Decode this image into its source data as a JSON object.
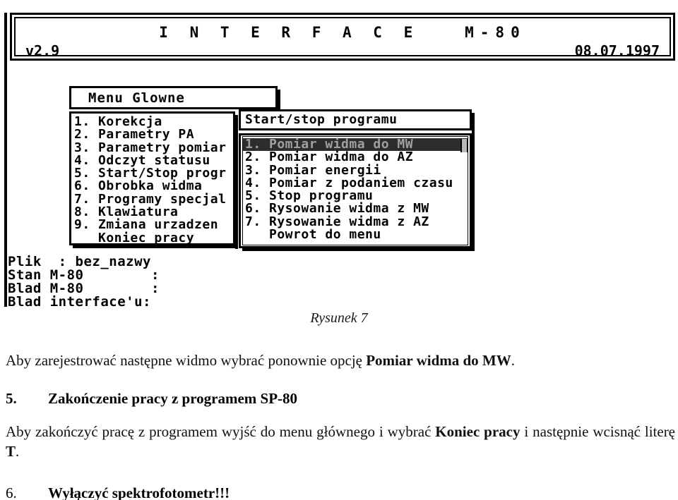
{
  "terminal": {
    "header": {
      "title": "I N T E R F A C E   M-80",
      "version": "v2.9",
      "date": "08.07.1997"
    },
    "main_menu": {
      "title": "Menu Glowne",
      "items": [
        "1. Korekcja",
        "2. Parametry PA",
        "3. Parametry pomiar",
        "4. Odczyt statusu",
        "5. Start/Stop progr",
        "6. Obrobka widma",
        "7. Programy specjal",
        "8. Klawiatura",
        "9. Zmiana urzadzen",
        "   Koniec pracy"
      ]
    },
    "submenu": {
      "title": "Start/stop programu",
      "selected_index": 0,
      "items": [
        "1. Pomiar widma do MW",
        "2. Pomiar widma do AZ",
        "3. Pomiar energii",
        "4. Pomiar z podaniem czasu",
        "5. Stop programu",
        "6. Rysowanie widma z MW",
        "7. Rysowanie widma z AZ",
        "   Powrot do menu"
      ]
    },
    "status": {
      "lines": [
        "Plik  : bez_nazwy",
        "Stan M-80        :",
        "Blad M-80        :",
        "Blad interface'u:"
      ]
    },
    "colors": {
      "selection_bg": "#2d2d2d",
      "selection_fg": "#a0a0a0",
      "border": "#000000",
      "background": "#ffffff",
      "scroll_thumb": "#b8b8b8"
    }
  },
  "document": {
    "figure_caption": "Rysunek 7",
    "paragraph_1_prefix": "Aby zarejestrować następne widmo wybrać ponownie opcję ",
    "paragraph_1_bold": "Pomiar widma do MW",
    "paragraph_1_suffix": ".",
    "heading_5_number": "5.",
    "heading_5_text": "Zakończenie pracy z programem SP-80",
    "paragraph_2_prefix": "Aby zakończyć pracę z programem wyjść do menu głównego i wybrać ",
    "paragraph_2_bold": "Koniec pracy",
    "paragraph_2_mid": " i następnie wcisnąć literę ",
    "paragraph_2_bold2": "T",
    "paragraph_2_suffix": ".",
    "heading_6_number": "6.",
    "heading_6_text": "Wyłączyć spektrofotometr!!!"
  }
}
